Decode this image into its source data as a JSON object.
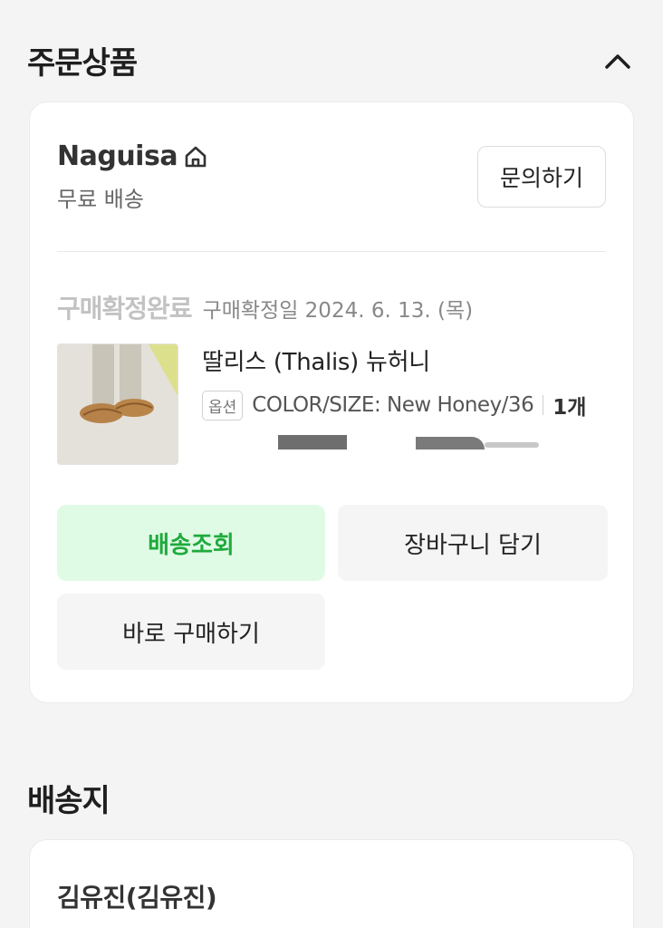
{
  "order_items": {
    "title": "주문상품",
    "collapse_icon": "chevron-up-icon"
  },
  "seller": {
    "name": "Naguisa",
    "home_icon": "home-icon",
    "shipping": "무료 배송",
    "inquiry_label": "문의하기"
  },
  "order": {
    "status": "구매확정완료",
    "confirm_date": "구매확정일 2024. 6. 13. (목)"
  },
  "product": {
    "name": "딸리스 (Thalis) 뉴허니",
    "option_badge": "옵션",
    "option_text": "COLOR/SIZE: New Honey/36",
    "quantity": "1개"
  },
  "actions": {
    "track_delivery": "배송조회",
    "add_to_cart": "장바구니 담기",
    "buy_now": "바로 구매하기"
  },
  "delivery": {
    "title": "배송지",
    "recipient": "김유진(김유진)"
  },
  "colors": {
    "accent_green": "#1faa3d",
    "green_bg": "#e0fbe5"
  }
}
